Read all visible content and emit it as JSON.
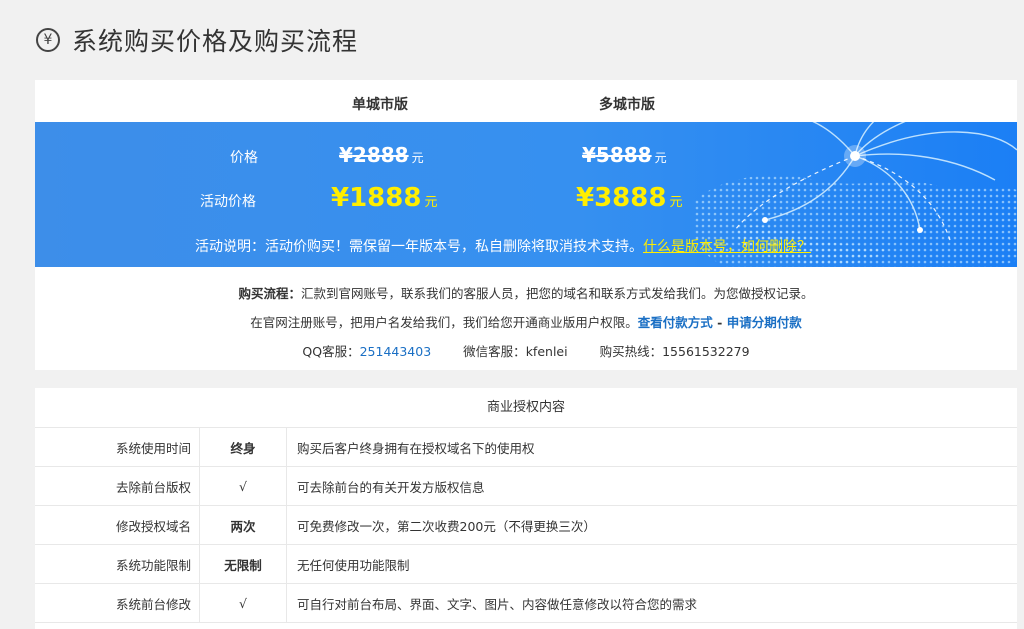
{
  "page": {
    "title": "系统购买价格及购买流程"
  },
  "columns": {
    "single": "单城市版",
    "multi": "多城市版"
  },
  "pricing": {
    "price_label": "价格",
    "promo_label": "活动价格",
    "currency": "¥",
    "unit": "元",
    "single_price": "2888",
    "single_promo": "1888",
    "multi_price": "5888",
    "multi_promo": "3888"
  },
  "notice": {
    "text": "活动说明：活动价购买！需保留一年版本号，私自删除将取消技术支持。",
    "link": "什么是版本号，如何删除？"
  },
  "process": {
    "label": "购买流程：",
    "line1": "汇款到官网账号，联系我们的客服人员，把您的域名和联系方式发给我们。为您做授权记录。",
    "line2": "在官网注册账号，把用户名发给我们，我们给您开通商业版用户权限。",
    "link_payment": "查看付款方式",
    "sep": " - ",
    "link_installment": "申请分期付款"
  },
  "contact": {
    "qq_label": "QQ客服：",
    "qq": "251443403",
    "wechat_label": "微信客服：",
    "wechat": "kfenlei",
    "hotline_label": "购买热线：",
    "hotline": "15561532279"
  },
  "license": {
    "heading": "商业授权内容",
    "rows": [
      {
        "name": "系统使用时间",
        "value": "终身",
        "desc": "购买后客户终身拥有在授权域名下的使用权"
      },
      {
        "name": "去除前台版权",
        "value": "√",
        "desc": "可去除前台的有关开发方版权信息"
      },
      {
        "name": "修改授权域名",
        "value": "两次",
        "desc": "可免费修改一次，第二次收费200元（不得更换三次）"
      },
      {
        "name": "系统功能限制",
        "value": "无限制",
        "desc": "无任何使用功能限制"
      },
      {
        "name": "系统前台修改",
        "value": "√",
        "desc": "可自行对前台布局、界面、文字、图片、内容做任意修改以符合您的需求"
      }
    ]
  },
  "colors": {
    "band": "#3a8ef0",
    "promo": "#ffee00",
    "link": "#1a6fc4"
  },
  "icons": {
    "title_icon": "yen-circle-icon"
  }
}
